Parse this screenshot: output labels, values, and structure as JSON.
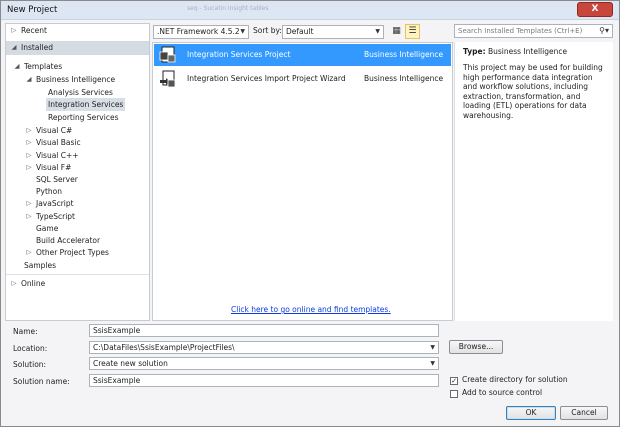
{
  "window": {
    "title": "New Project",
    "close_glyph": "X",
    "ghost_title": "seq - Sucatin Insight tables"
  },
  "nav": {
    "recent": "Recent",
    "installed": "Installed",
    "templates": "Templates",
    "business_intelligence": "Business Intelligence",
    "bi_children": [
      "Analysis Services",
      "Integration Services",
      "Reporting Services"
    ],
    "languages": [
      "Visual C#",
      "Visual Basic",
      "Visual C++",
      "Visual F#",
      "SQL Server",
      "Python",
      "JavaScript",
      "TypeScript",
      "Game",
      "Build Accelerator",
      "Other Project Types"
    ],
    "samples": "Samples",
    "online": "Online"
  },
  "toolbar": {
    "framework": ".NET Framework 4.5.2",
    "sort_label": "Sort by:",
    "sort_value": "Default",
    "search_placeholder": "Search Installed Templates (Ctrl+E)"
  },
  "templates": [
    {
      "name": "Integration Services Project",
      "category": "Business Intelligence",
      "selected": true,
      "icon": "ssis-project-icon"
    },
    {
      "name": "Integration Services Import Project Wizard",
      "category": "Business Intelligence",
      "selected": false,
      "icon": "import-wizard-icon"
    }
  ],
  "online_link": "Click here to go online and find templates.",
  "info": {
    "type_label": "Type:",
    "type_value": "Business Intelligence",
    "description": "This project may be used for building high performance data integration and workflow solutions, including extraction, transformation, and loading (ETL) operations for data warehousing."
  },
  "form": {
    "name_label": "Name:",
    "name_value": "SsisExample",
    "location_label": "Location:",
    "location_value": "C:\\DataFiles\\SsisExample\\ProjectFiles\\",
    "solution_label": "Solution:",
    "solution_value": "Create new solution",
    "solution_name_label": "Solution name:",
    "solution_name_value": "SsisExample",
    "browse": "Browse...",
    "create_dir": "Create directory for solution",
    "create_dir_checked": true,
    "source_control": "Add to source control",
    "source_control_checked": false,
    "ok": "OK",
    "cancel": "Cancel"
  }
}
